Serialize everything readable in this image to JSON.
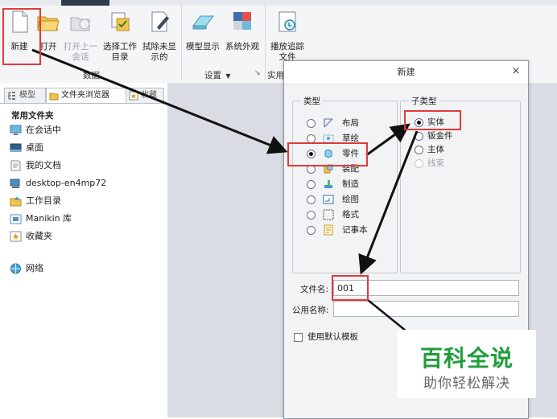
{
  "ribbon": {
    "buttons": {
      "new": "新建",
      "open": "打开",
      "open_last": "打开上一\n会话",
      "select_workdir": "选择工作\n目录",
      "erase": "拭除未显\n示的",
      "model_display": "模型显示",
      "system_appearance": "系统外观",
      "playback": "播放追踪\n文件"
    },
    "groups": {
      "data": "数据",
      "settings": "设置",
      "utilities": "实用"
    }
  },
  "left_panel": {
    "tabs": [
      "模型",
      "文件夹浏览器",
      "收藏"
    ],
    "section_title": "常用文件夹",
    "folders": [
      "在会话中",
      "桌面",
      "我的文档",
      "desktop-en4mp72",
      "工作目录",
      "Manikin 库",
      "收藏夹",
      "网络"
    ]
  },
  "dialog": {
    "title": "新建",
    "close": "×",
    "type_legend": "类型",
    "types": [
      {
        "label": "布局",
        "selected": false,
        "icon": "layout-icon"
      },
      {
        "label": "草绘",
        "selected": false,
        "icon": "sketch-icon"
      },
      {
        "label": "零件",
        "selected": true,
        "icon": "part-icon"
      },
      {
        "label": "装配",
        "selected": false,
        "icon": "assembly-icon"
      },
      {
        "label": "制造",
        "selected": false,
        "icon": "manufacturing-icon"
      },
      {
        "label": "绘图",
        "selected": false,
        "icon": "drawing-icon"
      },
      {
        "label": "格式",
        "selected": false,
        "icon": "format-icon"
      },
      {
        "label": "记事本",
        "selected": false,
        "icon": "notebook-icon"
      }
    ],
    "subtype_legend": "子类型",
    "subtypes": [
      {
        "label": "实体",
        "selected": true,
        "disabled": false
      },
      {
        "label": "钣金件",
        "selected": false,
        "disabled": false
      },
      {
        "label": "主体",
        "selected": false,
        "disabled": false
      },
      {
        "label": "线束",
        "selected": false,
        "disabled": true
      }
    ],
    "filename_label": "文件名:",
    "filename_value": "001",
    "common_name_label": "公用名称:",
    "common_name_value": "",
    "use_default_template": "使用默认模板",
    "use_default_template_checked": false
  },
  "watermark": {
    "title": "百科全说",
    "subtitle": "助你轻松解决"
  },
  "colors": {
    "highlight_red": "#e23a3a",
    "watermark_green": "#1f9d3a",
    "arrow": "#111111"
  }
}
